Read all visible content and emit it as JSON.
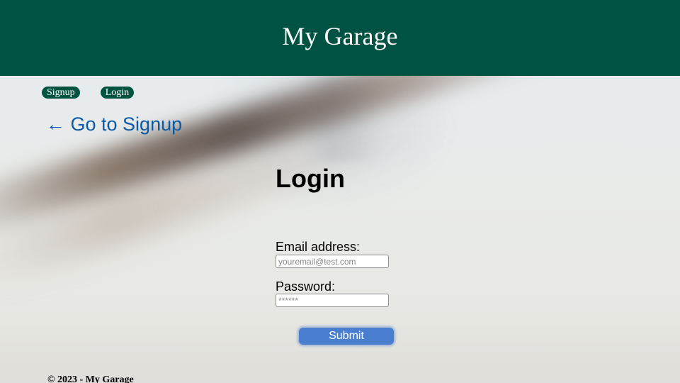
{
  "header": {
    "title": "My Garage",
    "background_color": "#005342"
  },
  "nav": {
    "items": [
      {
        "label": "Signup"
      },
      {
        "label": "Login"
      }
    ],
    "pill_color": "#00543f"
  },
  "back_link": {
    "label": "← Go to Signup",
    "color": "#0b5aa6"
  },
  "form": {
    "title": "Login",
    "email": {
      "label": "Email address:",
      "placeholder": "youremail@test.com",
      "value": ""
    },
    "password": {
      "label": "Password:",
      "placeholder": "******",
      "value": ""
    },
    "submit_label": "Submit",
    "submit_color": "#4a7fd0"
  },
  "footer": {
    "text": "© 2023 - My Garage"
  }
}
